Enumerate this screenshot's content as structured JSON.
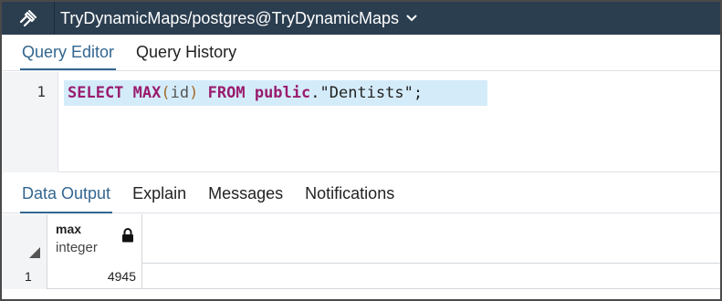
{
  "titlebar": {
    "connection_icon": "query-tool-icon",
    "connection_title": "TryDynamicMaps/postgres@TryDynamicMaps",
    "dropdown_icon": "chevron-down-icon"
  },
  "editor_tabs": [
    {
      "label": "Query Editor",
      "active": true
    },
    {
      "label": "Query History",
      "active": false
    }
  ],
  "editor": {
    "line_number": "1",
    "tokens": {
      "select": "SELECT",
      "max": "MAX",
      "open_paren": "(",
      "id": "id",
      "close_paren": ")",
      "from": "FROM",
      "schema": "public",
      "dot": ".",
      "table": "\"Dentists\"",
      "semicolon": ";"
    }
  },
  "output_tabs": [
    {
      "label": "Data Output",
      "active": true
    },
    {
      "label": "Explain",
      "active": false
    },
    {
      "label": "Messages",
      "active": false
    },
    {
      "label": "Notifications",
      "active": false
    }
  ],
  "result": {
    "columns": [
      {
        "name": "max",
        "type": "integer",
        "icon": "lock-icon"
      }
    ],
    "rows": [
      {
        "row_number": "1",
        "values": [
          "4945"
        ]
      }
    ]
  },
  "colors": {
    "titlebar_bg": "#2b3e50",
    "active_tab": "#326690",
    "keyword": "#9a1c6e",
    "line_highlight": "#d4ecfa"
  }
}
